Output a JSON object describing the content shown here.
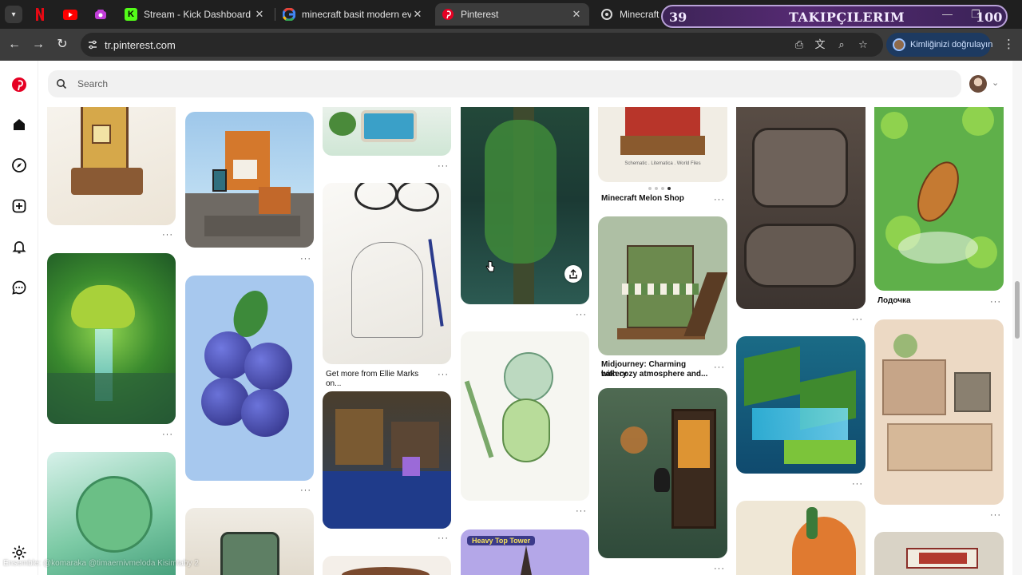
{
  "browser": {
    "tabs": [
      {
        "title": "Stream - Kick Dashboard",
        "favicon": "kick-icon"
      },
      {
        "title": "minecraft basit modern evler - G",
        "favicon": "google-icon"
      },
      {
        "title": "Pinterest",
        "favicon": "pinterest-icon",
        "active": true
      },
      {
        "title": "Minecraft köp",
        "favicon": "minecraft-icon"
      }
    ],
    "url": "tr.pinterest.com",
    "verify_label": "Kimliğinizi doğrulayın"
  },
  "overlay": {
    "left_number": "39",
    "title": "TAKIPÇILERIM",
    "right_number": "100"
  },
  "search": {
    "placeholder": "Search"
  },
  "pins": [
    {
      "title": "Minecraft Melon Shop"
    },
    {
      "title": "Get more from Ellie Marks on..."
    },
    {
      "title_line1": "Midjourney: Charming bakery",
      "title_line2": "with cozy atmosphere and..."
    },
    {
      "title": "Лодочка"
    },
    {
      "label": "Heavy Top Tower"
    },
    {
      "caption": "Schematic . Litematica . World Files"
    }
  ],
  "watermark": "Ensemble: @komaraka @timaernivmeloda Kisimtaby 2",
  "colors": {
    "accent": "#e60023",
    "verify_bg": "#1d3a61"
  }
}
